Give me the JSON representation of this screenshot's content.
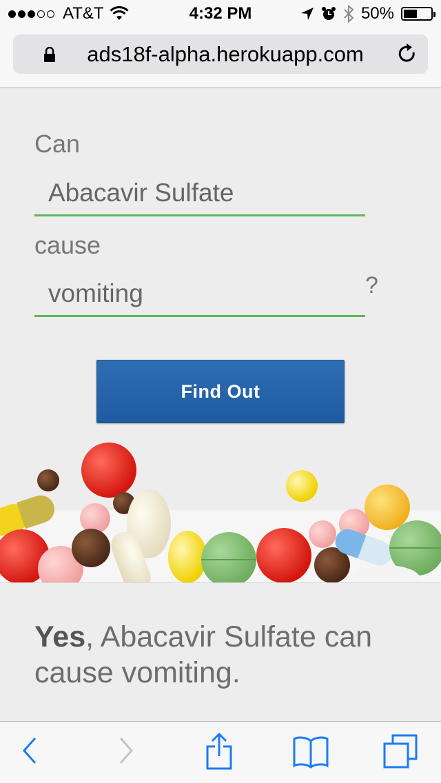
{
  "status_bar": {
    "carrier": "AT&T",
    "signal_bars": 3,
    "time": "4:32 PM",
    "battery": "50%",
    "battery_level": 0.5
  },
  "browser": {
    "url": "ads18f-alpha.herokuapp.com"
  },
  "form": {
    "label_can": "Can",
    "drug_value": "Abacavir Sulfate",
    "label_cause": "cause",
    "effect_value": "vomiting",
    "question_mark": "?",
    "button_label": "Find Out"
  },
  "result": {
    "answer": "Yes",
    "text": ", Abacavir Sulfate can cause vomiting."
  },
  "colors": {
    "accent_green": "#5cb85c",
    "button_blue": "#2a64a8",
    "toolbar_blue": "#1a7cf4"
  },
  "icons": [
    "wifi-icon",
    "lock-icon",
    "reload-icon",
    "location-icon",
    "alarm-icon",
    "bluetooth-icon",
    "back-icon",
    "forward-icon",
    "share-icon",
    "bookmarks-icon",
    "tabs-icon"
  ]
}
